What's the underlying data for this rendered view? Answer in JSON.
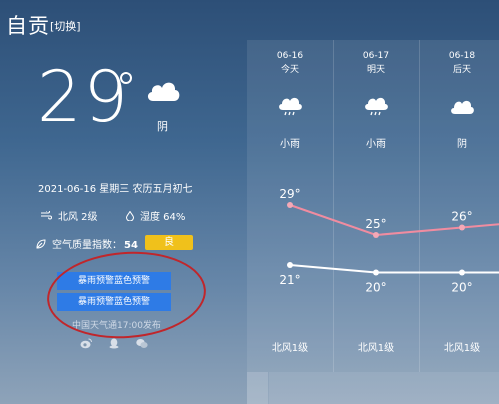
{
  "header": {
    "city": "自贡",
    "switch_label": "[切换]"
  },
  "current": {
    "temperature": "29",
    "condition": "阴",
    "condition_icon": "cloud-icon",
    "date_line": "2021-06-16 星期三 农历五月初七",
    "wind": "北风 2级",
    "humidity": "湿度 64%",
    "aqi_label": "空气质量指数：",
    "aqi_value": "54",
    "aqi_level": "良",
    "aqi_color": "#f0c11b"
  },
  "warnings": {
    "items": [
      "暴雨预警蓝色预警",
      "暴雨预警蓝色预警"
    ],
    "color": "#2e7be6",
    "publish_note": "中国天气通17:00发布"
  },
  "share_icons": [
    "weibo-icon",
    "qq-icon",
    "wechat-icon"
  ],
  "forecast": {
    "days": [
      {
        "date": "06-16",
        "day": "今天",
        "condition": "小雨",
        "icon": "rain-cloud-icon",
        "wind": "北风1级"
      },
      {
        "date": "06-17",
        "day": "明天",
        "condition": "小雨",
        "icon": "rain-cloud-icon",
        "wind": "北风1级"
      },
      {
        "date": "06-18",
        "day": "后天",
        "condition": "阴",
        "icon": "cloud-icon",
        "wind": "北风1级"
      }
    ]
  },
  "chart_data": {
    "type": "line",
    "categories": [
      "06-16",
      "06-17",
      "06-18"
    ],
    "series": [
      {
        "values": [
          29,
          25,
          26
        ],
        "labels": [
          "29°",
          "25°",
          "26°"
        ],
        "color": "#f08ca0"
      },
      {
        "values": [
          21,
          20,
          20
        ],
        "labels": [
          "21°",
          "20°",
          "20°"
        ],
        "color": "#ffffff"
      }
    ]
  }
}
